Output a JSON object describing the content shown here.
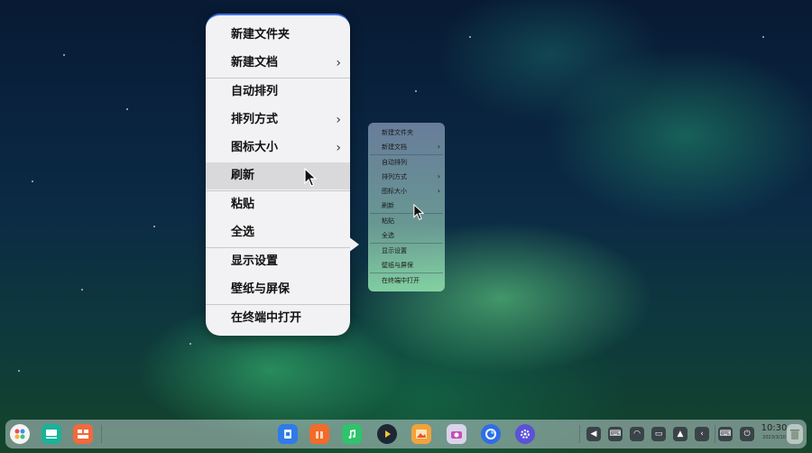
{
  "context_menu": {
    "items": [
      {
        "label": "新建文件夹",
        "submenu": false
      },
      {
        "label": "新建文档",
        "submenu": true
      },
      {
        "label": "自动排列",
        "submenu": false
      },
      {
        "label": "排列方式",
        "submenu": true
      },
      {
        "label": "图标大小",
        "submenu": true
      },
      {
        "label": "刷新",
        "submenu": false,
        "highlighted": true
      },
      {
        "label": "粘贴",
        "submenu": false
      },
      {
        "label": "全选",
        "submenu": false
      },
      {
        "label": "显示设置",
        "submenu": false
      },
      {
        "label": "壁纸与屏保",
        "submenu": false
      },
      {
        "label": "在终端中打开",
        "submenu": false
      }
    ],
    "submenu_glyph": "›"
  },
  "preview_menu": {
    "items": [
      "新建文件夹",
      "新建文档",
      "自动排列",
      "排列方式",
      "图标大小",
      "刷新",
      "粘贴",
      "全选",
      "显示设置",
      "壁纸与屏保",
      "在终端中打开"
    ],
    "submenu_glyph": "›"
  },
  "dock": {
    "left_apps": [
      {
        "name": "launcher-icon",
        "color": "#f0f0f0"
      },
      {
        "name": "multitask-view-icon",
        "color": "#19b39a"
      },
      {
        "name": "workspace-icon",
        "color": "#f06a3c"
      }
    ],
    "center_apps": [
      {
        "name": "file-manager-icon",
        "color": "#2f7be8"
      },
      {
        "name": "app-store-icon",
        "color": "#f26b2a"
      },
      {
        "name": "music-icon",
        "color": "#2fc46b"
      },
      {
        "name": "movie-icon",
        "color": "#222a3a"
      },
      {
        "name": "image-viewer-icon",
        "color": "#f3a23a"
      },
      {
        "name": "camera-icon",
        "color": "#c74fb5"
      },
      {
        "name": "browser-icon",
        "color": "#2e6de8"
      },
      {
        "name": "control-center-icon",
        "color": "#5a52d8"
      }
    ],
    "tray": [
      {
        "name": "volume-icon",
        "glyph": "◀"
      },
      {
        "name": "keyboard-icon",
        "glyph": "⌨"
      },
      {
        "name": "wifi-icon",
        "glyph": "◠"
      },
      {
        "name": "battery-icon",
        "glyph": "▭"
      },
      {
        "name": "notification-icon",
        "glyph": "▲"
      },
      {
        "name": "collapse-tray-icon",
        "glyph": "‹"
      },
      {
        "name": "onscreen-keyboard-icon",
        "glyph": "⌨"
      },
      {
        "name": "power-icon",
        "glyph": "⏻"
      }
    ],
    "clock_time": "10:30",
    "clock_date": "2023/3/10",
    "trash_icon": "trash-icon"
  }
}
